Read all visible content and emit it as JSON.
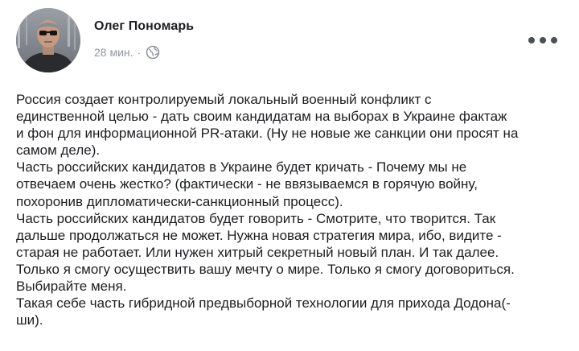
{
  "post": {
    "author": "Олег Пономарь",
    "time": "28 мин.",
    "separator": "·",
    "privacy_icon": "globe-icon",
    "more_icon": "more-options-icon",
    "avatar_icon": "profile-photo",
    "lines": [
      "Россия создает контролируемый локальный военный конфликт с",
      "единственной целью - дать своим кандидатам на выборах в Украине фактаж",
      "и фон для информационной PR-атаки. (Ну не новые же санкции они просят на",
      "самом деле).",
      "Часть российских кандидатов в Украине будет кричать - Почему мы не",
      "отвечаем очень жестко? (фактически - не ввязываемся в горячую войну,",
      "похоронив дипломатически-санкционный процесс).",
      "Часть российских кандидатов будет говорить - Смотрите, что творится. Так",
      "дальше продолжаться не может. Нужна новая стратегия мира, ибо, видите -",
      "старая не работает. Или нужен хитрый секретный новый план. И так далее.",
      "Только я смогу осуществить вашу мечту о мире. Только я смогу договориться.",
      "Выбирайте меня.",
      "Такая себе часть гибридной предвыборной технологии для прихода Додона(-",
      "ши)."
    ]
  },
  "colors": {
    "text": "#1c1e21",
    "meta": "#90949c",
    "icon": "#4b4f56"
  }
}
